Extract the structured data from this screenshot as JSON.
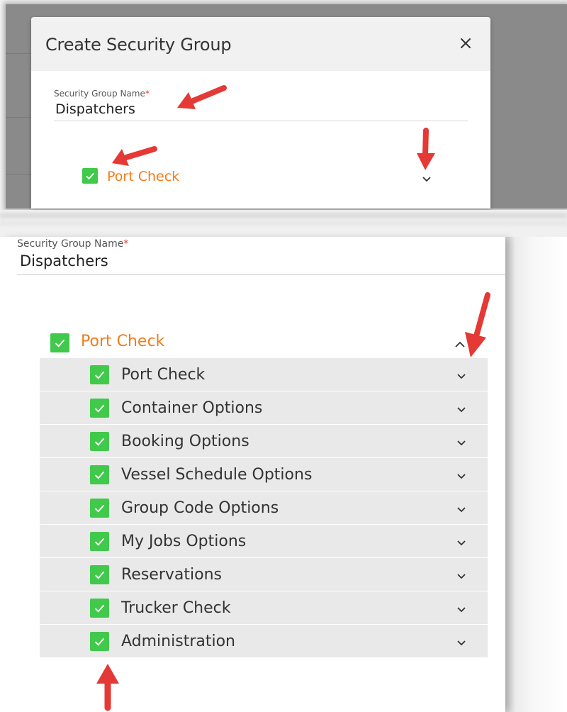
{
  "dialog": {
    "title": "Create Security Group",
    "field_label": "Security Group Name",
    "required_mark": "*",
    "field_value": "Dispatchers",
    "group_label": "Port Check",
    "close_icon": "close-icon",
    "chevron_icon": "chevron-down-icon"
  },
  "expanded": {
    "field_label": "Security Group Name",
    "required_mark": "*",
    "field_value": "Dispatchers",
    "group_label": "Port Check",
    "group_chevron_icon": "chevron-up-icon",
    "options": [
      {
        "label": "Port Check",
        "checked": true
      },
      {
        "label": "Container Options",
        "checked": true
      },
      {
        "label": "Booking Options",
        "checked": true
      },
      {
        "label": "Vessel Schedule Options",
        "checked": true
      },
      {
        "label": "Group Code Options",
        "checked": true
      },
      {
        "label": "My Jobs Options",
        "checked": true
      },
      {
        "label": "Reservations",
        "checked": true
      },
      {
        "label": "Trucker Check",
        "checked": true
      },
      {
        "label": "Administration",
        "checked": true
      }
    ]
  },
  "colors": {
    "checkbox": "#40c94a",
    "accent_orange": "#f37b18",
    "required_red": "#e53935",
    "annotation_arrow": "#e53935",
    "row_background": "#e9e9e9"
  }
}
